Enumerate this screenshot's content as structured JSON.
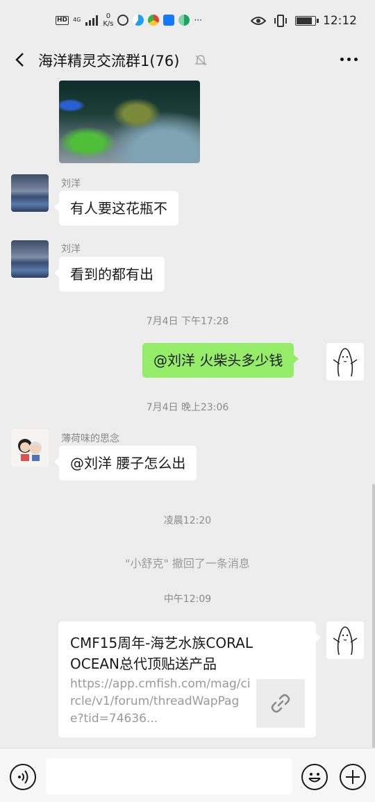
{
  "status_bar": {
    "hd": "HD",
    "network": "4G",
    "speed_value": "0",
    "speed_unit": "K/s",
    "more": "···",
    "time": "12:12"
  },
  "header": {
    "title": "海洋精灵交流群1(76)"
  },
  "messages": [
    {
      "sender": "刘洋",
      "text": "有人要这花瓶不"
    },
    {
      "sender": "刘洋",
      "text": "看到的都有出"
    },
    {
      "timestamp": "7月4日 下午17:28"
    },
    {
      "self_text": "@刘洋  火柴头多少钱"
    },
    {
      "timestamp": "7月4日 晚上23:06"
    },
    {
      "sender": "薄荷味的思念",
      "text": "@刘洋  腰子怎么出"
    },
    {
      "timestamp": "凌晨12:20"
    },
    {
      "system": "\"小舒克\" 撤回了一条消息"
    },
    {
      "timestamp": "中午12:09"
    }
  ],
  "link_card": {
    "title": "CMF15周年-海艺水族CORAL OCEAN总代顶贴送产品",
    "url": "https://app.cmfish.com/mag/circle/v1/forum/threadWapPage?tid=74636..."
  },
  "colors": {
    "background": "#ededed",
    "self_bubble": "#95ec69",
    "other_bubble": "#ffffff"
  },
  "icons": [
    "back-icon",
    "mute-icon",
    "more-icon",
    "voice-icon",
    "emoji-icon",
    "plus-icon",
    "link-icon"
  ]
}
